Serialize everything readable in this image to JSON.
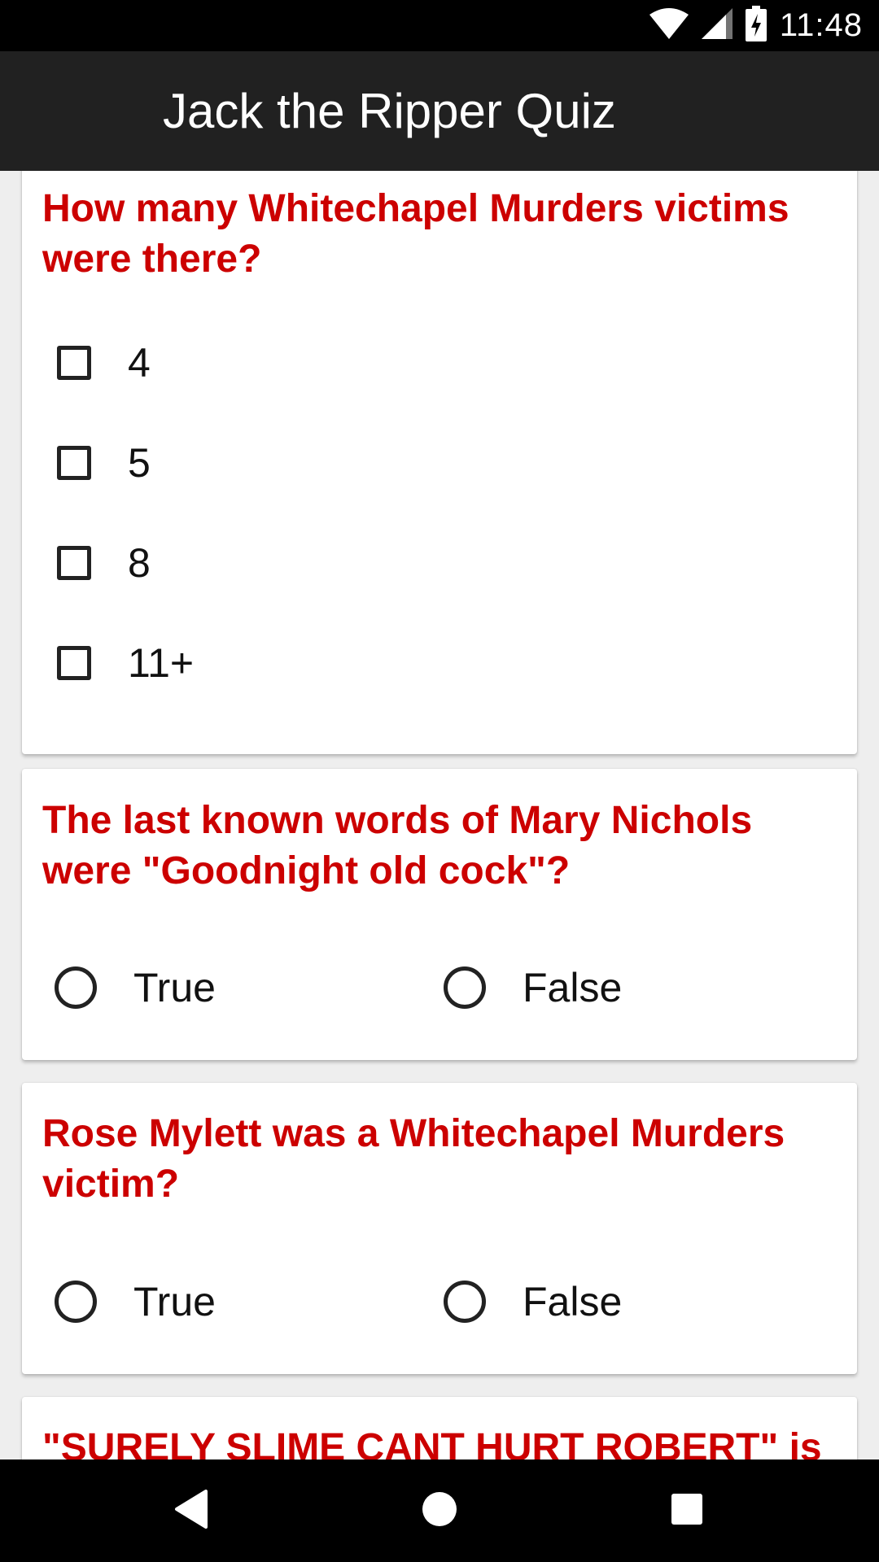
{
  "status_bar": {
    "time": "11:48",
    "icons": [
      "wifi-icon",
      "cell-signal-icon",
      "battery-charging-icon"
    ]
  },
  "app_bar": {
    "title": "Jack the Ripper Quiz"
  },
  "colors": {
    "question_text": "#cc0000",
    "app_bar": "#212121",
    "background": "#eeeeee",
    "card": "#ffffff"
  },
  "questions": [
    {
      "text": "How many Whitechapel Murders victims were there?",
      "type": "checkbox",
      "options": [
        "4",
        "5",
        "8",
        "11+"
      ]
    },
    {
      "text": "The last known words of Mary Nichols were \"Goodnight old cock\"?",
      "type": "radio",
      "options": [
        "True",
        "False"
      ]
    },
    {
      "text": "Rose Mylett was a Whitechapel Murders victim?",
      "type": "radio",
      "options": [
        "True",
        "False"
      ]
    },
    {
      "text": "\"SURELY SLIME CANT HURT ROBERT\" is",
      "type": "partial"
    }
  ],
  "nav_bar": {
    "buttons": [
      "back-icon",
      "home-icon",
      "recents-icon"
    ]
  }
}
